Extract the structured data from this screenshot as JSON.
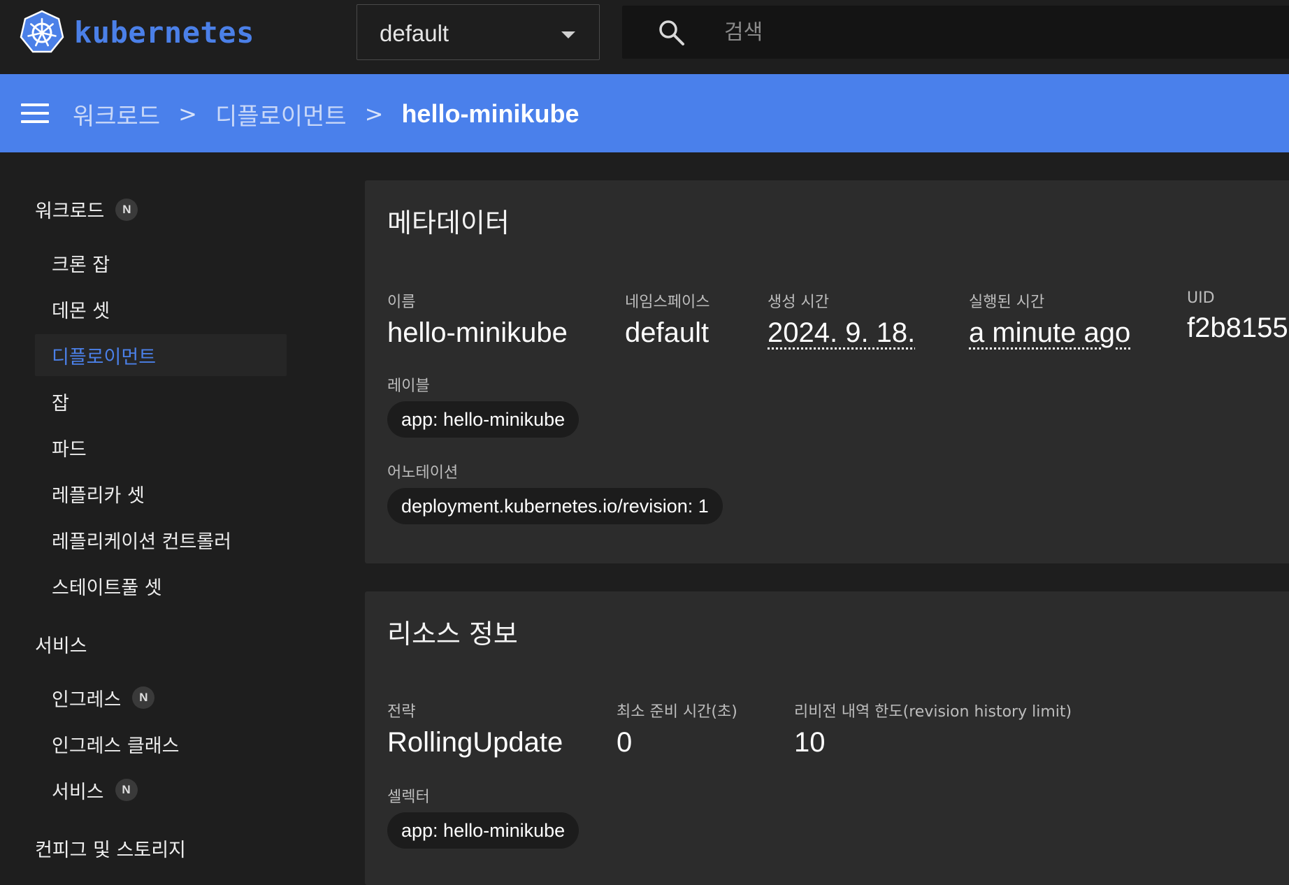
{
  "header": {
    "brand": "kubernetes",
    "namespace": "default",
    "search_placeholder": "검색",
    "colors": {
      "brand": "#4b80e8",
      "bar": "#4a80eb"
    }
  },
  "breadcrumb": {
    "items": [
      "워크로드",
      "디플로이먼트"
    ],
    "current": "hello-minikube",
    "separator": ">"
  },
  "sidebar": {
    "groups": [
      {
        "label": "워크로드",
        "badge": "N"
      },
      {
        "label": "서비스"
      },
      {
        "label": "컨피그 및 스토리지"
      }
    ],
    "workload_items": [
      "크론 잡",
      "데몬 셋",
      "디플로이먼트",
      "잡",
      "파드",
      "레플리카 셋",
      "레플리케이션 컨트롤러",
      "스테이트풀 셋"
    ],
    "service_items": [
      {
        "label": "인그레스",
        "badge": "N"
      },
      {
        "label": "인그레스 클래스"
      },
      {
        "label": "서비스",
        "badge": "N"
      }
    ],
    "active": "디플로이먼트"
  },
  "metadata": {
    "title": "메타데이터",
    "name_label": "이름",
    "name": "hello-minikube",
    "namespace_label": "네임스페이스",
    "namespace": "default",
    "created_label": "생성 시간",
    "created": "2024. 9. 18.",
    "age_label": "실행된 시간",
    "age": "a minute ago",
    "uid_label": "UID",
    "uid": "f2b8155",
    "labels_label": "레이블",
    "labels": [
      "app: hello-minikube"
    ],
    "annotations_label": "어노테이션",
    "annotations": [
      "deployment.kubernetes.io/revision: 1"
    ]
  },
  "resource": {
    "title": "리소스 정보",
    "strategy_label": "전략",
    "strategy": "RollingUpdate",
    "min_ready_label": "최소 준비 시간(초)",
    "min_ready": "0",
    "revision_label": "리비전 내역 한도(revision history limit)",
    "revision": "10",
    "selector_label": "셀렉터",
    "selector": [
      "app: hello-minikube"
    ]
  }
}
